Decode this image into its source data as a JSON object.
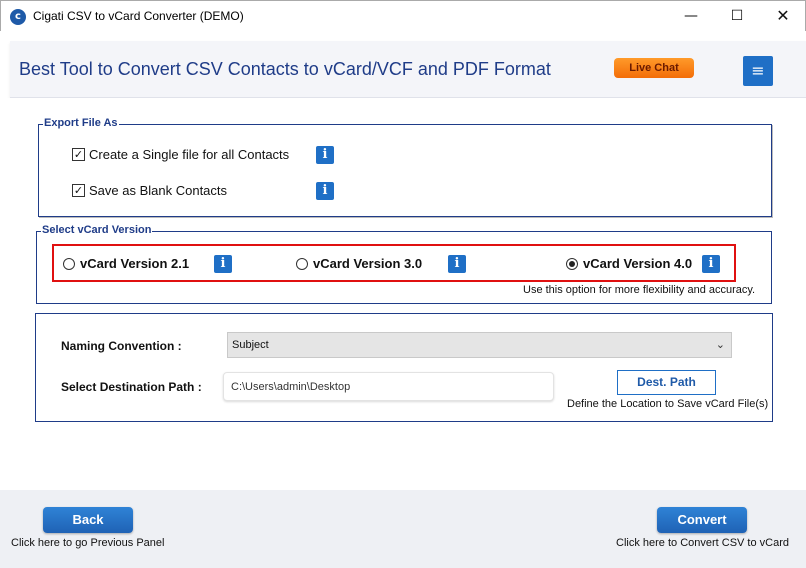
{
  "window": {
    "title": "Cigati CSV to vCard Converter (DEMO)",
    "app_icon_glyph": "c",
    "minimize_glyph": "—",
    "maximize_glyph": "☐",
    "close_glyph": "✕"
  },
  "header": {
    "title": "Best Tool to Convert CSV Contacts to vCard/VCF and PDF Format",
    "live_chat_label": "Live Chat",
    "menu_glyph": "≡"
  },
  "export_group": {
    "legend": "Export File As",
    "options": [
      {
        "label": "Create a Single file for all Contacts",
        "checked": true
      },
      {
        "label": "Save as Blank Contacts",
        "checked": true
      }
    ],
    "check_glyph": "✓",
    "info_glyph": "i"
  },
  "version_group": {
    "legend": "Select vCard Version",
    "options": [
      {
        "label": "vCard Version 2.1",
        "checked": false
      },
      {
        "label": "vCard Version 3.0",
        "checked": false
      },
      {
        "label": "vCard Version 4.0",
        "checked": true
      }
    ],
    "hint": "Use this option for more flexibility and accuracy.",
    "highlight_color": "#e01010"
  },
  "naming_group": {
    "naming_label": "Naming Convention :",
    "naming_value": "Subject",
    "chevron_glyph": "⌄",
    "dest_label": "Select Destination Path :",
    "dest_value": "C:\\Users\\admin\\Desktop",
    "dest_button": "Dest. Path",
    "dest_hint": "Define the Location to Save vCard File(s)"
  },
  "footer": {
    "back_label": "Back",
    "back_hint": "Click here to go Previous Panel",
    "convert_label": "Convert",
    "convert_hint": "Click here to Convert CSV to vCard"
  },
  "colors": {
    "accent": "#1f6fc6",
    "title_blue": "#1f3c88",
    "live_chat": "#f36d08"
  }
}
